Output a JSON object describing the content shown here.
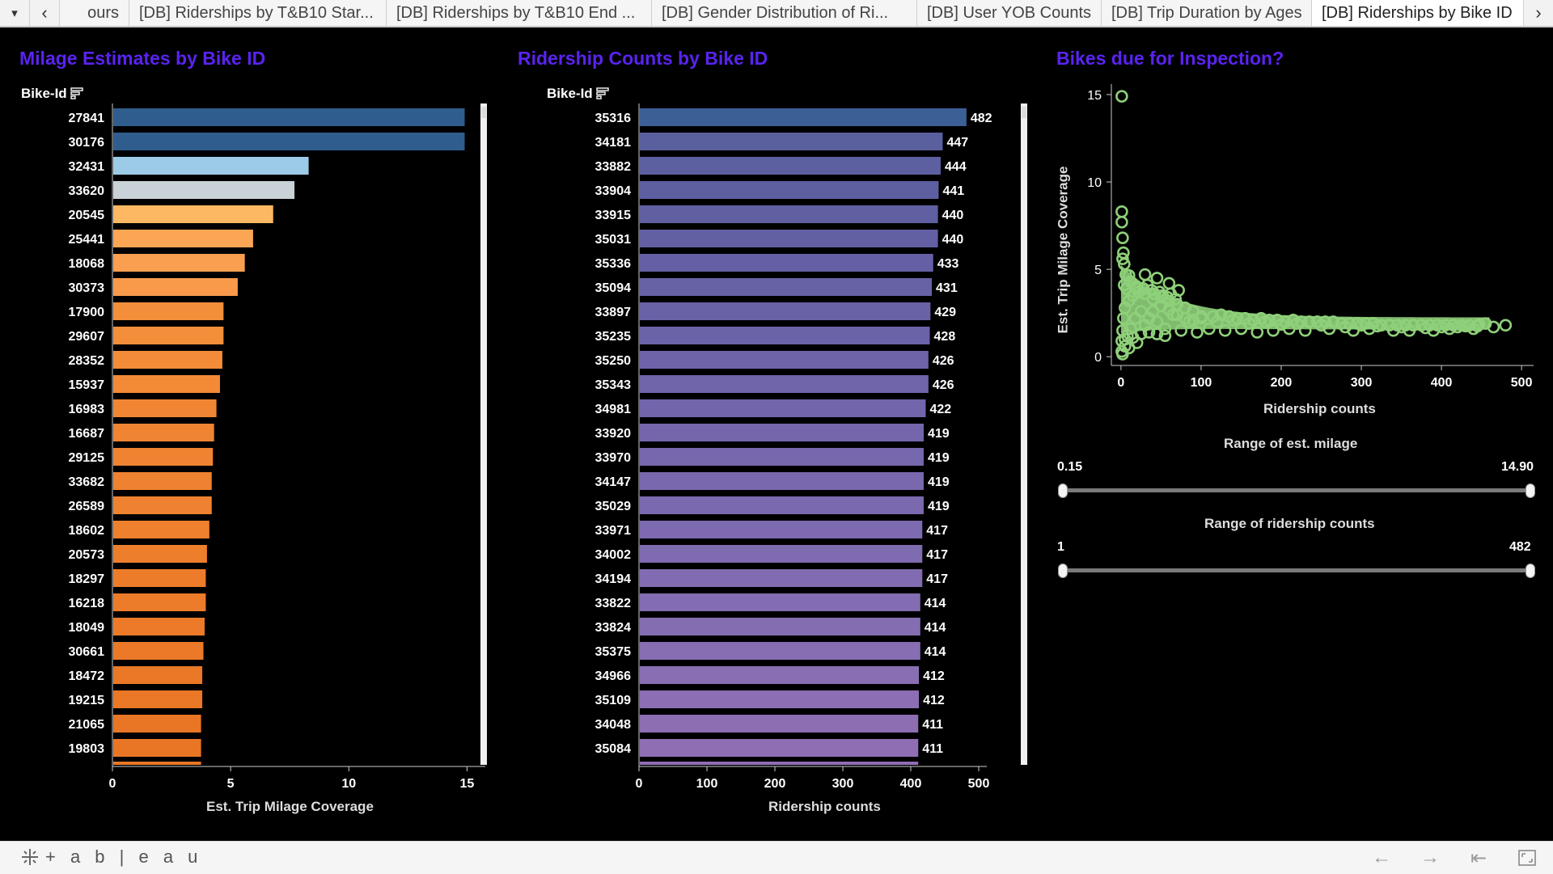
{
  "tabs": [
    {
      "label": "ours"
    },
    {
      "label": "[DB] Riderships by T&B10 Star..."
    },
    {
      "label": "[DB] Riderships by T&B10 End ..."
    },
    {
      "label": "[DB] Gender Distribution of Ri..."
    },
    {
      "label": "[DB] User YOB Counts"
    },
    {
      "label": "[DB] Trip Duration by Ages"
    },
    {
      "label": "[DB] Riderships by Bike ID",
      "active": true
    }
  ],
  "tabbar": {
    "menu_icon": "▾",
    "prev_icon": "‹",
    "next_icon": "›"
  },
  "milage": {
    "title": "Milage Estimates by Bike ID",
    "column_header": "Bike-Id",
    "xlabel": "Est. Trip Milage Coverage"
  },
  "ridership": {
    "title": "Ridership Counts by Bike ID",
    "column_header": "Bike-Id",
    "xlabel": "Ridership counts"
  },
  "inspection": {
    "title": "Bikes due for Inspection?",
    "xlabel": "Ridership counts",
    "ylabel": "Est. Trip Milage Coverage"
  },
  "filters": {
    "milage_range": {
      "title": "Range of est. milage",
      "min_label": "0.15",
      "max_label": "14.90",
      "low": 0.0,
      "high": 1.0
    },
    "ridership_range": {
      "title": "Range of ridership counts",
      "min_label": "1",
      "max_label": "482",
      "low": 0.0,
      "high": 1.0
    }
  },
  "brand": {
    "text": "+ a b | e a u"
  },
  "colors": {
    "title_accent": "#5a23f0",
    "milage_gradient": [
      "#2f5e8e",
      "#9ccbe8",
      "#c9d2d6",
      "#fdb863",
      "#e8661f"
    ],
    "ridership_gradient": [
      "#3c5f95",
      "#9a6db4"
    ],
    "scatter": "#8fd07a"
  },
  "chart_data": [
    {
      "type": "bar",
      "orientation": "horizontal",
      "title": "Milage Estimates by Bike ID",
      "ylabel": "Bike-Id",
      "xlabel": "Est. Trip Milage Coverage",
      "xlim": [
        0,
        15.5
      ],
      "xticks": [
        0,
        5,
        10,
        15
      ],
      "categories": [
        "27841",
        "30176",
        "32431",
        "33620",
        "20545",
        "25441",
        "18068",
        "30373",
        "17900",
        "29607",
        "28352",
        "15937",
        "16983",
        "16687",
        "29125",
        "33682",
        "26589",
        "18602",
        "20573",
        "18297",
        "16218",
        "18049",
        "30661",
        "18472",
        "19215",
        "21065",
        "19803"
      ],
      "values": [
        14.9,
        14.9,
        8.3,
        7.7,
        6.8,
        5.95,
        5.6,
        5.3,
        4.7,
        4.7,
        4.65,
        4.55,
        4.4,
        4.3,
        4.25,
        4.2,
        4.2,
        4.1,
        4.0,
        3.95,
        3.95,
        3.9,
        3.85,
        3.8,
        3.8,
        3.75,
        3.75
      ],
      "colors": [
        "#2f5e8e",
        "#2f5e8e",
        "#9ccbe8",
        "#c9d2d6",
        "#fdb863",
        "#fba655",
        "#f99f4f",
        "#f99a4a",
        "#f38e3a",
        "#f38e3a",
        "#f28c39",
        "#f28a37",
        "#f08634",
        "#ef8432",
        "#ef8331",
        "#ef8230",
        "#ef8230",
        "#ee802e",
        "#ed7e2c",
        "#ec7c2a",
        "#ec7c2a",
        "#ec7a29",
        "#eb7928",
        "#ea7826",
        "#ea7826",
        "#e97625",
        "#e97625"
      ]
    },
    {
      "type": "bar",
      "orientation": "horizontal",
      "title": "Ridership Counts by Bike ID",
      "ylabel": "Bike-Id",
      "xlabel": "Ridership counts",
      "xlim": [
        0,
        500
      ],
      "xticks": [
        0,
        100,
        200,
        300,
        400,
        500
      ],
      "categories": [
        "35316",
        "34181",
        "33882",
        "33904",
        "33915",
        "35031",
        "35336",
        "35094",
        "33897",
        "35235",
        "35250",
        "35343",
        "34981",
        "33920",
        "33970",
        "34147",
        "35029",
        "33971",
        "34002",
        "34194",
        "33822",
        "33824",
        "35375",
        "34966",
        "35109",
        "34048",
        "35084"
      ],
      "values": [
        482,
        447,
        444,
        441,
        440,
        440,
        433,
        431,
        429,
        428,
        426,
        426,
        422,
        419,
        419,
        419,
        419,
        417,
        417,
        417,
        414,
        414,
        414,
        412,
        412,
        411,
        411
      ],
      "data_labels": [
        "482",
        "447",
        "444",
        "441",
        "440",
        "440",
        "433",
        "431",
        "429",
        "428",
        "426",
        "426",
        "422",
        "419",
        "419",
        "419",
        "419",
        "417",
        "417",
        "417",
        "414",
        "414",
        "414",
        "412",
        "412",
        "411",
        "411"
      ],
      "colors": [
        "#3c5f95",
        "#5a5f9e",
        "#5c5fa0",
        "#5e5fa1",
        "#605fa2",
        "#625fa3",
        "#6560a5",
        "#6761a6",
        "#6962a7",
        "#6b63a8",
        "#6e63a9",
        "#7064aa",
        "#7365ab",
        "#7566ac",
        "#7767ad",
        "#7968ae",
        "#7b69af",
        "#7d6ab0",
        "#7f6bb0",
        "#816cb1",
        "#836cb1",
        "#856db2",
        "#876eb2",
        "#896eb3",
        "#8b6eb3",
        "#8d6eb3",
        "#906eb4"
      ]
    },
    {
      "type": "scatter",
      "title": "Bikes due for Inspection?",
      "xlabel": "Ridership counts",
      "ylabel": "Est. Trip Milage Coverage",
      "xlim": [
        -12,
        515
      ],
      "ylim": [
        -0.5,
        15.6
      ],
      "xticks": [
        0,
        100,
        200,
        300,
        400,
        500
      ],
      "yticks": [
        0,
        5,
        10,
        15
      ],
      "points": [
        [
          1,
          14.9
        ],
        [
          1,
          8.3
        ],
        [
          1,
          7.7
        ],
        [
          2,
          6.8
        ],
        [
          3,
          5.95
        ],
        [
          2,
          5.6
        ],
        [
          4,
          5.3
        ],
        [
          6,
          4.7
        ],
        [
          10,
          4.65
        ],
        [
          30,
          4.7
        ],
        [
          45,
          4.5
        ],
        [
          60,
          4.2
        ],
        [
          72,
          3.8
        ],
        [
          480,
          1.8
        ],
        [
          455,
          1.9
        ],
        [
          447,
          1.85
        ],
        [
          430,
          1.75
        ],
        [
          420,
          1.7
        ],
        [
          400,
          1.7
        ],
        [
          380,
          1.65
        ],
        [
          350,
          1.7
        ],
        [
          320,
          1.75
        ],
        [
          300,
          1.8
        ],
        [
          280,
          1.7
        ],
        [
          250,
          1.8
        ],
        [
          220,
          1.9
        ],
        [
          200,
          1.85
        ],
        [
          180,
          2.0
        ],
        [
          160,
          1.9
        ],
        [
          140,
          2.1
        ],
        [
          120,
          2.0
        ],
        [
          100,
          2.3
        ],
        [
          90,
          2.6
        ],
        [
          80,
          2.8
        ],
        [
          70,
          3.0
        ],
        [
          60,
          3.2
        ],
        [
          50,
          3.4
        ],
        [
          40,
          3.3
        ],
        [
          30,
          3.6
        ],
        [
          20,
          3.9
        ],
        [
          15,
          3.5
        ],
        [
          10,
          3.2
        ],
        [
          5,
          2.8
        ],
        [
          3,
          2.2
        ],
        [
          2,
          1.5
        ],
        [
          1,
          0.9
        ],
        [
          1,
          0.3
        ],
        [
          2,
          0.15
        ],
        [
          5,
          0.6
        ],
        [
          8,
          1.2
        ],
        [
          12,
          1.6
        ],
        [
          18,
          2.2
        ],
        [
          25,
          2.6
        ],
        [
          35,
          2.2
        ],
        [
          45,
          2.0
        ],
        [
          55,
          1.6
        ],
        [
          65,
          2.4
        ],
        [
          75,
          1.5
        ],
        [
          85,
          2.0
        ],
        [
          95,
          1.4
        ],
        [
          110,
          1.6
        ],
        [
          130,
          1.5
        ],
        [
          150,
          1.6
        ],
        [
          170,
          1.4
        ],
        [
          190,
          1.5
        ],
        [
          210,
          1.6
        ],
        [
          230,
          1.5
        ],
        [
          260,
          1.6
        ],
        [
          290,
          1.5
        ],
        [
          310,
          1.6
        ],
        [
          340,
          1.5
        ],
        [
          360,
          1.5
        ],
        [
          390,
          1.5
        ],
        [
          410,
          1.6
        ],
        [
          440,
          1.6
        ],
        [
          465,
          1.7
        ],
        [
          5,
          1.0
        ],
        [
          15,
          1.1
        ],
        [
          25,
          1.3
        ],
        [
          35,
          1.4
        ],
        [
          45,
          1.3
        ],
        [
          55,
          1.2
        ],
        [
          20,
          0.8
        ],
        [
          10,
          0.5
        ],
        [
          30,
          1.8
        ],
        [
          40,
          2.6
        ],
        [
          50,
          2.9
        ],
        [
          60,
          2.7
        ],
        [
          70,
          2.4
        ],
        [
          80,
          2.2
        ],
        [
          90,
          2.1
        ],
        [
          100,
          2.2
        ],
        [
          115,
          2.3
        ],
        [
          125,
          2.4
        ],
        [
          135,
          2.3
        ],
        [
          145,
          2.2
        ],
        [
          155,
          2.2
        ],
        [
          165,
          2.1
        ],
        [
          175,
          2.2
        ],
        [
          185,
          2.1
        ],
        [
          195,
          2.1
        ],
        [
          205,
          2.0
        ],
        [
          215,
          2.1
        ],
        [
          225,
          2.0
        ],
        [
          235,
          2.0
        ],
        [
          245,
          2.0
        ],
        [
          255,
          2.0
        ],
        [
          265,
          2.0
        ],
        [
          275,
          1.9
        ],
        [
          285,
          1.9
        ],
        [
          295,
          1.9
        ],
        [
          305,
          1.9
        ],
        [
          315,
          1.9
        ],
        [
          325,
          1.8
        ],
        [
          335,
          1.8
        ],
        [
          345,
          1.8
        ],
        [
          355,
          1.8
        ],
        [
          365,
          1.8
        ],
        [
          375,
          1.8
        ],
        [
          385,
          1.8
        ],
        [
          395,
          1.8
        ],
        [
          405,
          1.8
        ],
        [
          415,
          1.8
        ],
        [
          425,
          1.8
        ],
        [
          435,
          1.8
        ],
        [
          445,
          1.75
        ],
        [
          4,
          4.1
        ],
        [
          7,
          3.9
        ],
        [
          12,
          4.3
        ],
        [
          18,
          4.0
        ],
        [
          22,
          3.7
        ],
        [
          28,
          3.9
        ],
        [
          33,
          4.1
        ],
        [
          38,
          3.8
        ],
        [
          42,
          3.6
        ],
        [
          48,
          3.7
        ],
        [
          52,
          3.5
        ],
        [
          58,
          3.4
        ],
        [
          62,
          3.6
        ],
        [
          68,
          3.3
        ]
      ]
    }
  ]
}
